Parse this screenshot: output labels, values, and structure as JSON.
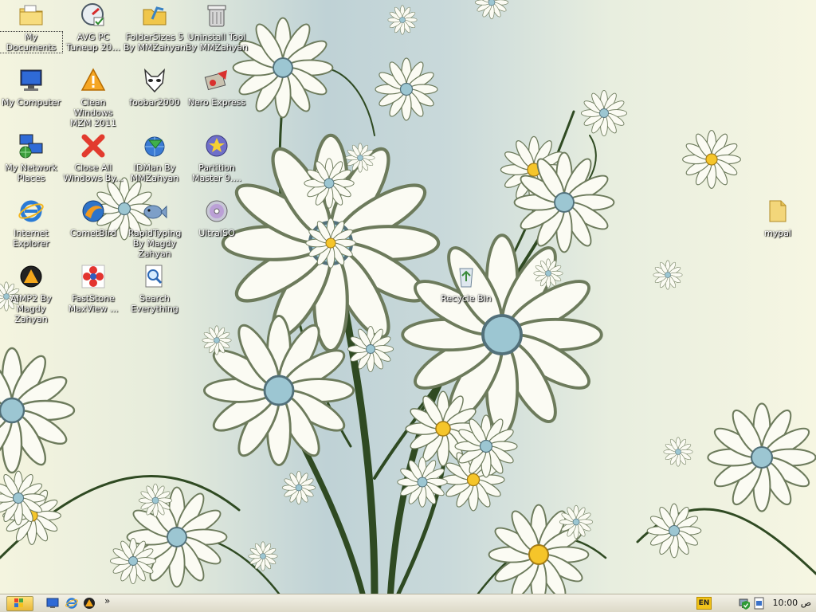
{
  "desktop_icons": [
    {
      "name": "my-documents",
      "label": "My Documents",
      "icon": "folder-documents-icon",
      "selected": true
    },
    {
      "name": "avg-pc-tuneup",
      "label": "AVG PC Tuneup 20...",
      "icon": "avg-tuneup-icon"
    },
    {
      "name": "foldersizes",
      "label": "FolderSizes 5 By MMZahyan",
      "icon": "folder-chart-icon"
    },
    {
      "name": "uninstall-tool",
      "label": "Uninstall Tool By MMZahyan",
      "icon": "trash-bin-icon"
    },
    {
      "name": "my-computer",
      "label": "My Computer",
      "icon": "monitor-icon"
    },
    {
      "name": "clean-windows",
      "label": "Clean Windows MZM 2011",
      "icon": "warning-triangle-icon"
    },
    {
      "name": "foobar2000",
      "label": "foobar2000",
      "icon": "fox-mask-icon"
    },
    {
      "name": "nero-express",
      "label": "Nero Express",
      "icon": "nero-icon"
    },
    {
      "name": "my-network-places",
      "label": "My Network Places",
      "icon": "network-icon"
    },
    {
      "name": "close-all-windows",
      "label": "Close All Windows By...",
      "icon": "red-x-icon"
    },
    {
      "name": "idman",
      "label": "IDMan By MMZahyan",
      "icon": "download-globe-icon"
    },
    {
      "name": "partition-master",
      "label": "Partition Master 9....",
      "icon": "partition-disc-icon"
    },
    {
      "name": "internet-explorer",
      "label": "Internet Explorer",
      "icon": "ie-icon"
    },
    {
      "name": "cometbird",
      "label": "CometBird",
      "icon": "cometbird-icon"
    },
    {
      "name": "rapidtyping",
      "label": "RapidTyping By Magdy Zahyan",
      "icon": "fish-icon"
    },
    {
      "name": "ultraiso",
      "label": "UltraISO",
      "icon": "cd-disc-icon"
    },
    {
      "name": "aimp2",
      "label": "AIMP2 By Magdy Zahyan",
      "icon": "aimp-icon"
    },
    {
      "name": "faststone",
      "label": "FastStone MaxView ...",
      "icon": "faststone-flower-icon"
    },
    {
      "name": "search-everything",
      "label": "Search Everything",
      "icon": "search-document-icon"
    },
    {
      "name": "recycle-bin",
      "label": "Recycle Bin",
      "icon": "recycle-bin-icon"
    },
    {
      "name": "mypal",
      "label": "mypal",
      "icon": "folder-icon"
    }
  ],
  "taskbar": {
    "quick_launch": [
      {
        "name": "show-desktop",
        "icon": "show-desktop-icon"
      },
      {
        "name": "internet-explorer",
        "icon": "ie-icon"
      },
      {
        "name": "aimp",
        "icon": "aimp-icon"
      }
    ],
    "chevron": "»",
    "language": "EN",
    "tray_icons": [
      "network-status-icon",
      "security-shield-icon",
      "document-icon"
    ],
    "ampm": "ص",
    "time": "10:00"
  },
  "colors": {
    "accent": "#f1c31a",
    "label_text": "#ffffff",
    "taskbar": "#ece9d8"
  }
}
